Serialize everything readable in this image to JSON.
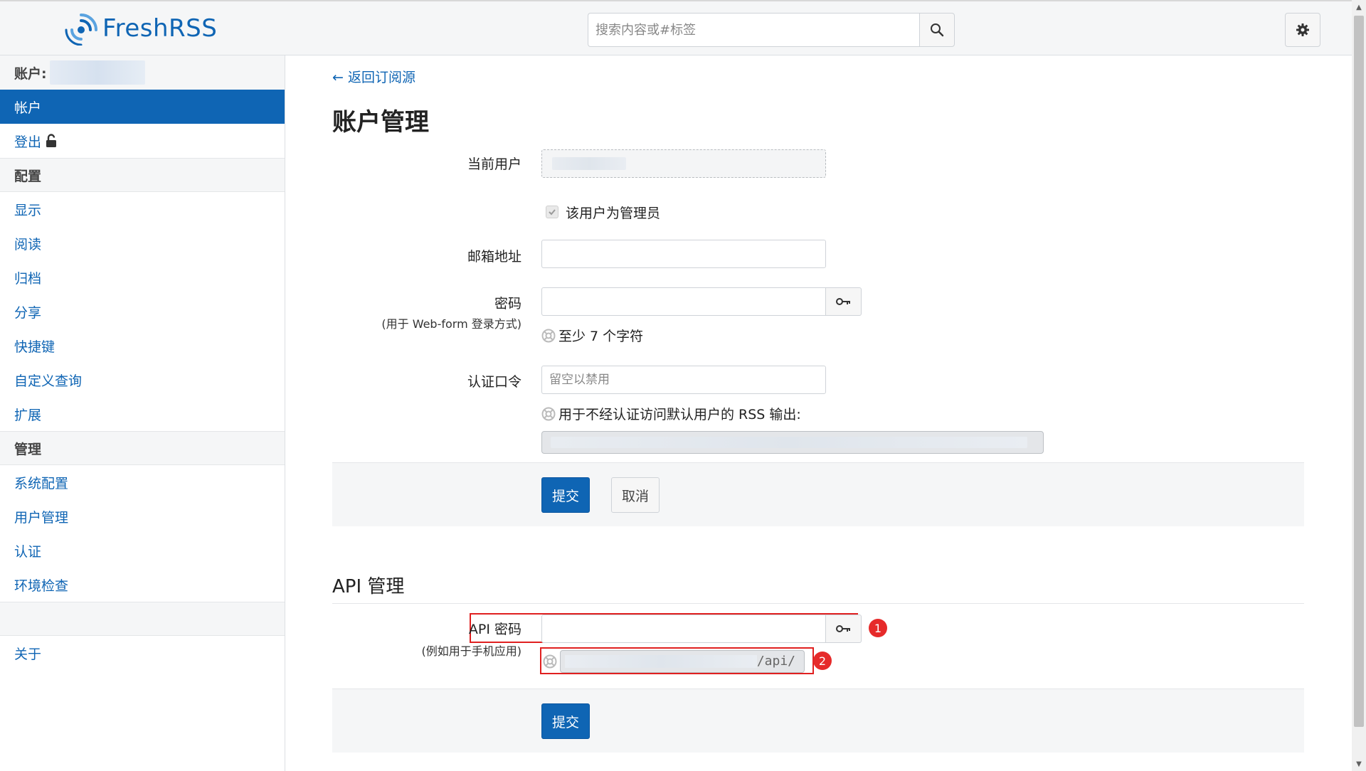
{
  "header": {
    "logo_text": "FreshRSS",
    "search_placeholder": "搜索内容或#标签"
  },
  "sidebar": {
    "account_label": "账户:",
    "items": [
      {
        "type": "item",
        "label": "帐户",
        "active": true
      },
      {
        "type": "item",
        "label": "登出",
        "icon": "lock-icon"
      },
      {
        "type": "category",
        "label": "配置"
      },
      {
        "type": "item",
        "label": "显示"
      },
      {
        "type": "item",
        "label": "阅读"
      },
      {
        "type": "item",
        "label": "归档"
      },
      {
        "type": "item",
        "label": "分享"
      },
      {
        "type": "item",
        "label": "快捷键"
      },
      {
        "type": "item",
        "label": "自定义查询"
      },
      {
        "type": "item",
        "label": "扩展"
      },
      {
        "type": "category",
        "label": "管理"
      },
      {
        "type": "item",
        "label": "系统配置"
      },
      {
        "type": "item",
        "label": "用户管理"
      },
      {
        "type": "item",
        "label": "认证"
      },
      {
        "type": "item",
        "label": "环境检查"
      },
      {
        "type": "spacer"
      },
      {
        "type": "item",
        "label": "关于"
      }
    ]
  },
  "main": {
    "back_link": "← 返回订阅源",
    "page_title": "账户管理",
    "form": {
      "current_user_label": "当前用户",
      "admin_checkbox_label": "该用户为管理员",
      "email_label": "邮箱地址",
      "email_value": "",
      "password_label": "密码",
      "password_sublabel": "(用于 Web-form 登录方式)",
      "password_hint": "至少 7 个字符",
      "token_label": "认证口令",
      "token_placeholder": "留空以禁用",
      "token_hint": "用于不经认证访问默认用户的 RSS 输出:",
      "submit_label": "提交",
      "cancel_label": "取消"
    },
    "api": {
      "section_title": "API 管理",
      "password_label": "API 密码",
      "password_sublabel": "(例如用于手机应用)",
      "url_suffix": "/api/",
      "submit_label": "提交",
      "annotation_1": "1",
      "annotation_2": "2"
    }
  },
  "colors": {
    "accent": "#0f65b4",
    "annotation_red": "#e02020"
  }
}
